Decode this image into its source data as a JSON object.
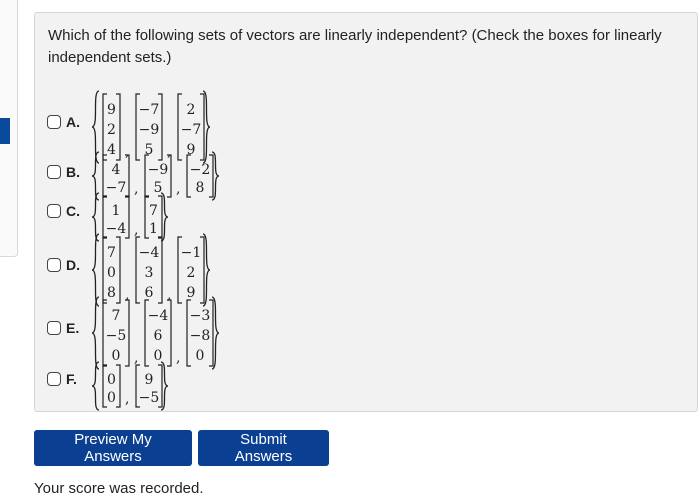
{
  "question": {
    "text": "Which of the following sets of vectors are linearly independent? (Check the boxes for linearly independent sets.)"
  },
  "options": [
    {
      "letter": "A.",
      "checked": false,
      "vectors": [
        [
          "9",
          "2",
          "4"
        ],
        [
          "−7",
          "−9",
          "5"
        ],
        [
          "2",
          "−7",
          "9"
        ]
      ]
    },
    {
      "letter": "B.",
      "checked": false,
      "vectors": [
        [
          "4",
          "−7"
        ],
        [
          "−9",
          "5"
        ],
        [
          "−2",
          "8"
        ]
      ]
    },
    {
      "letter": "C.",
      "checked": false,
      "vectors": [
        [
          "1",
          "−4"
        ],
        [
          "7",
          "1"
        ]
      ]
    },
    {
      "letter": "D.",
      "checked": false,
      "vectors": [
        [
          "7",
          "0",
          "8"
        ],
        [
          "−4",
          "3",
          "6"
        ],
        [
          "−1",
          "2",
          "9"
        ]
      ]
    },
    {
      "letter": "E.",
      "checked": false,
      "vectors": [
        [
          "7",
          "−5",
          "0"
        ],
        [
          "−4",
          "6",
          "0"
        ],
        [
          "−3",
          "−8",
          "0"
        ]
      ]
    },
    {
      "letter": "F.",
      "checked": false,
      "vectors": [
        [
          "0",
          "0"
        ],
        [
          "9",
          "−5"
        ]
      ]
    }
  ],
  "buttons": {
    "preview": "Preview My Answers",
    "submit": "Submit Answers"
  },
  "status": {
    "score_message": "Your score was recorded."
  },
  "colors": {
    "button_bg": "#0b3f91",
    "panel_bg": "#f2f2f2"
  }
}
